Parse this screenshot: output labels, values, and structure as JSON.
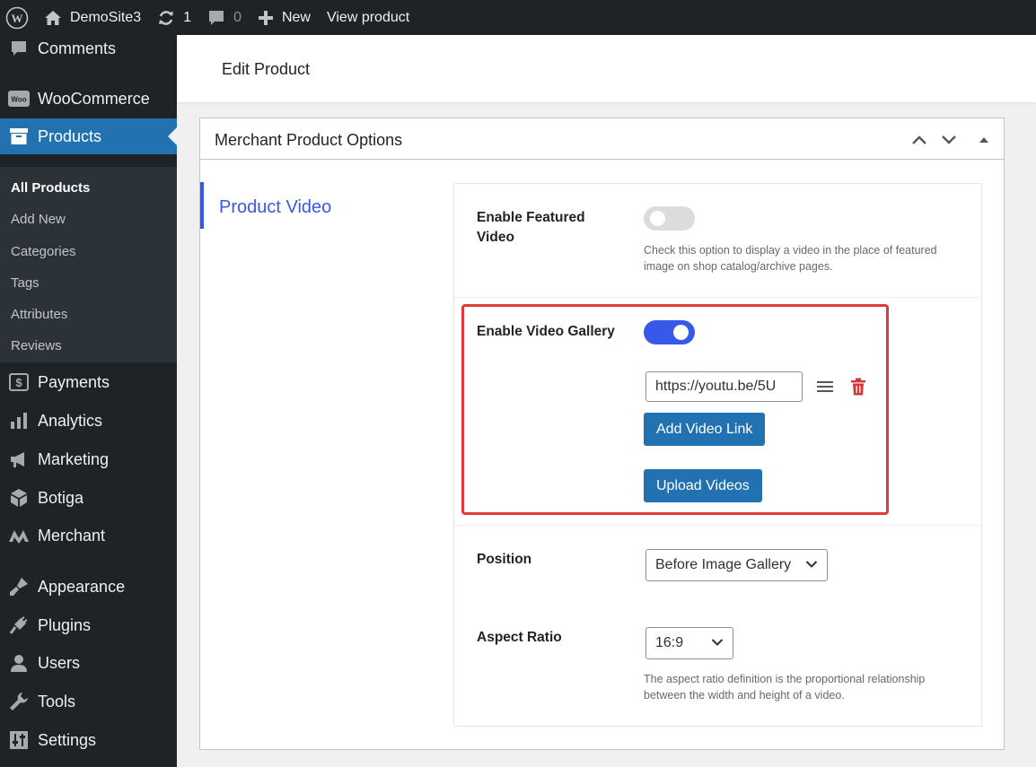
{
  "admin_bar": {
    "site_name": "DemoSite3",
    "updates_count": "1",
    "comments_count": "0",
    "new_label": "New",
    "view_product_label": "View product"
  },
  "sidebar": {
    "items": [
      {
        "label": "Comments",
        "icon": "comment-icon"
      },
      {
        "label": "WooCommerce",
        "icon": "woo-icon"
      },
      {
        "label": "Products",
        "icon": "archive-icon"
      },
      {
        "label": "Payments",
        "icon": "payments-icon"
      },
      {
        "label": "Analytics",
        "icon": "bar-chart-icon"
      },
      {
        "label": "Marketing",
        "icon": "megaphone-icon"
      },
      {
        "label": "Botiga",
        "icon": "cube-icon"
      },
      {
        "label": "Merchant",
        "icon": "merchant-icon"
      },
      {
        "label": "Appearance",
        "icon": "brush-icon"
      },
      {
        "label": "Plugins",
        "icon": "plugin-icon"
      },
      {
        "label": "Users",
        "icon": "user-icon"
      },
      {
        "label": "Tools",
        "icon": "wrench-icon"
      },
      {
        "label": "Settings",
        "icon": "sliders-icon"
      }
    ],
    "submenu": [
      "All Products",
      "Add New",
      "Categories",
      "Tags",
      "Attributes",
      "Reviews"
    ],
    "woo_badge": "Woo"
  },
  "header": {
    "title": "Edit Product"
  },
  "metabox": {
    "title": "Merchant Product Options",
    "tab_label": "Product Video",
    "featured_video": {
      "label": "Enable Featured Video",
      "description": "Check this option to display a video in the place of featured image on shop catalog/archive pages.",
      "enabled": false
    },
    "video_gallery": {
      "label": "Enable Video Gallery",
      "enabled": true,
      "link_value": "https://youtu.be/5U",
      "add_link_label": "Add Video Link",
      "upload_label": "Upload Videos"
    },
    "position": {
      "label": "Position",
      "value": "Before Image Gallery"
    },
    "aspect_ratio": {
      "label": "Aspect Ratio",
      "value": "16:9",
      "description": "The aspect ratio definition is the proportional relationship between the width and height of a video."
    }
  },
  "colors": {
    "admin_dark": "#1d2327",
    "primary_blue": "#2271b1",
    "accent_blue": "#3858e9",
    "highlight_red": "#e03b3b",
    "trash_red": "#d63638"
  }
}
